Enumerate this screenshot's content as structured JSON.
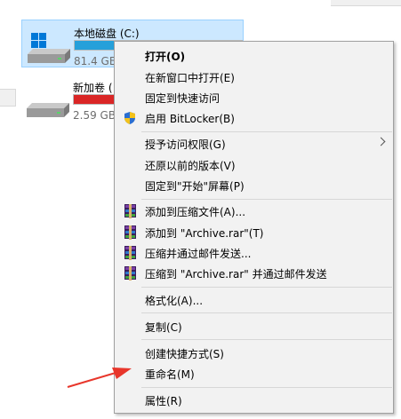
{
  "drives": [
    {
      "name": "本地磁盘 (C:)",
      "size_text": "81.4 GB",
      "used_fraction": 1.0,
      "bar_color": "#26a0da",
      "selected": true
    },
    {
      "name": "新加卷 (",
      "size_text": "2.59 GB",
      "used_fraction": 1.0,
      "bar_color": "#da2626",
      "selected": false
    }
  ],
  "menu": {
    "items": [
      {
        "label": "打开(O)",
        "bold": true
      },
      {
        "label": "在新窗口中打开(E)"
      },
      {
        "label": "固定到快速访问"
      },
      {
        "label": "启用 BitLocker(B)",
        "icon": "shield-icon"
      },
      {
        "label": "授予访问权限(G)",
        "submenu": true
      },
      {
        "label": "还原以前的版本(V)"
      },
      {
        "label": "固定到\"开始\"屏幕(P)"
      },
      {
        "label": "添加到压缩文件(A)...",
        "icon": "winrar-icon"
      },
      {
        "label": "添加到 \"Archive.rar\"(T)",
        "icon": "winrar-icon"
      },
      {
        "label": "压缩并通过邮件发送...",
        "icon": "winrar-icon"
      },
      {
        "label": "压缩到 \"Archive.rar\" 并通过邮件发送",
        "icon": "winrar-icon"
      },
      {
        "label": "格式化(A)..."
      },
      {
        "label": "复制(C)"
      },
      {
        "label": "创建快捷方式(S)"
      },
      {
        "label": "重命名(M)"
      },
      {
        "label": "属性(R)"
      }
    ]
  },
  "colors": {
    "selection_bg": "#cce8ff",
    "menu_bg": "#f2f2f2",
    "annotation_arrow": "#e8362b"
  }
}
